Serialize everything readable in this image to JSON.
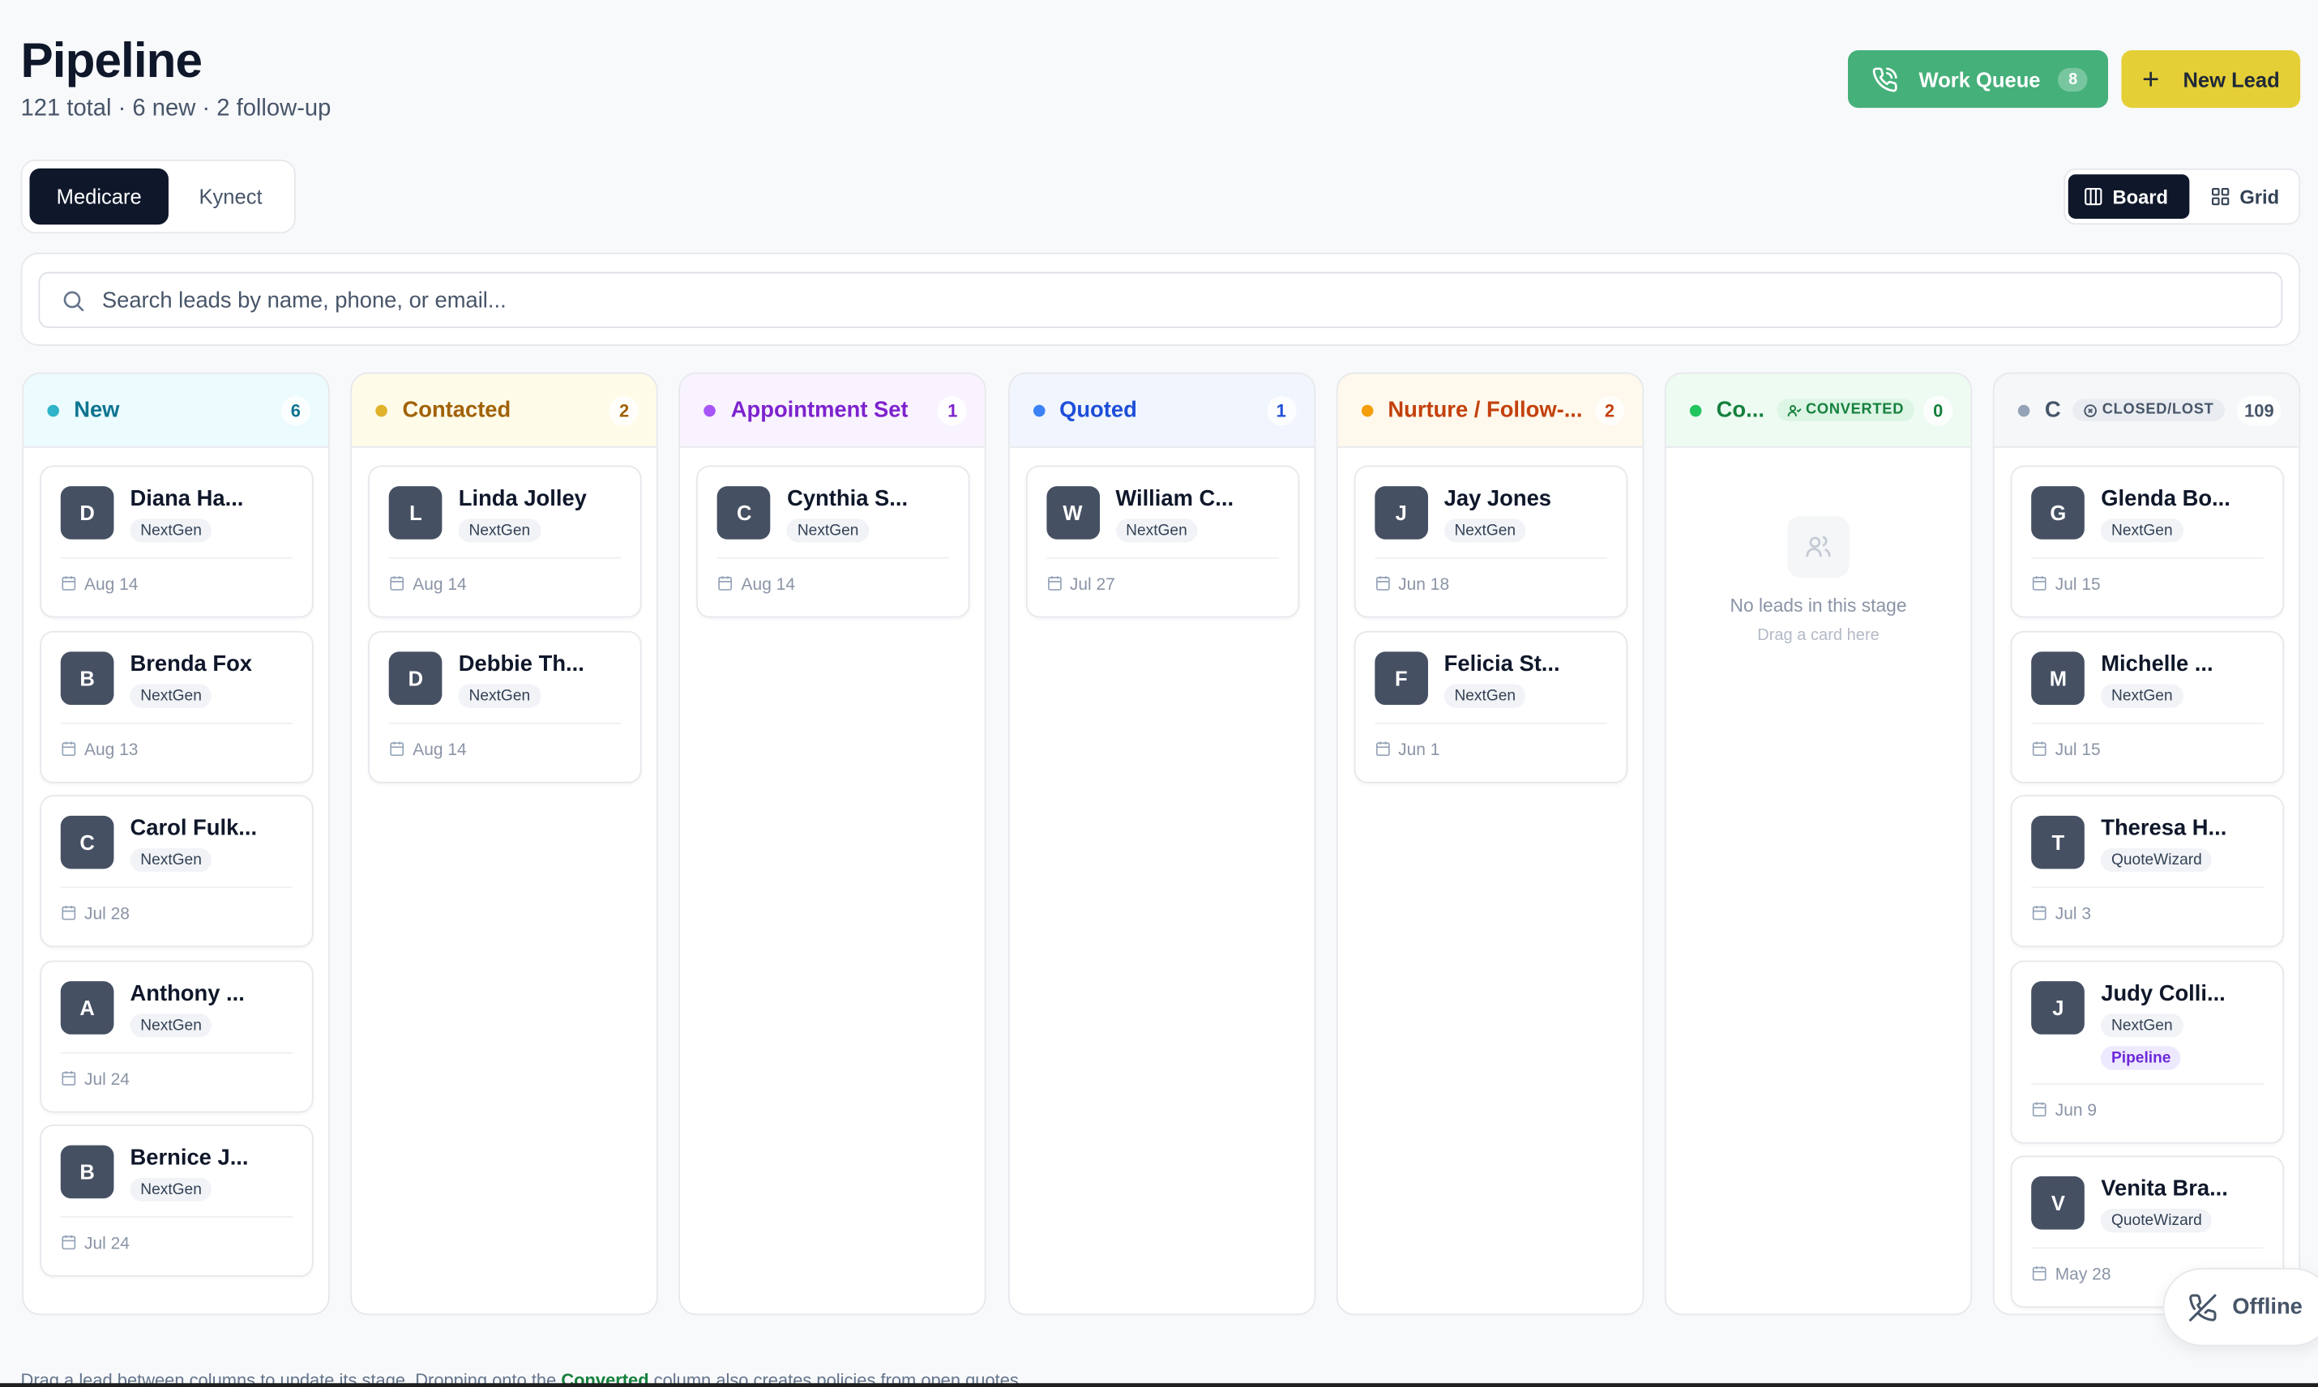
{
  "header": {
    "title": "Pipeline",
    "subtitle": "121 total · 6 new · 2 follow-up",
    "work_queue_label": "Work Queue",
    "work_queue_count": "8",
    "new_lead_label": "New Lead"
  },
  "product_tabs": [
    {
      "label": "Medicare",
      "active": true
    },
    {
      "label": "Kynect",
      "active": false
    }
  ],
  "view_toggle": {
    "board": "Board",
    "grid": "Grid",
    "active": "Board"
  },
  "search": {
    "placeholder": "Search leads by name, phone, or email..."
  },
  "columns": [
    {
      "name": "New",
      "count": "6",
      "color": "#2fb3c9",
      "text_color": "#0e7490",
      "head_bg": "#ecfbfd",
      "cards": [
        {
          "initial": "D",
          "name": "Diana Ha...",
          "source": "NextGen",
          "date": "Aug 14"
        },
        {
          "initial": "B",
          "name": "Brenda Fox",
          "source": "NextGen",
          "date": "Aug 13"
        },
        {
          "initial": "C",
          "name": "Carol Fulk...",
          "source": "NextGen",
          "date": "Jul 28"
        },
        {
          "initial": "A",
          "name": "Anthony ...",
          "source": "NextGen",
          "date": "Jul 24"
        },
        {
          "initial": "B",
          "name": "Bernice J...",
          "source": "NextGen",
          "date": "Jul 24"
        }
      ]
    },
    {
      "name": "Contacted",
      "count": "2",
      "color": "#e0b12a",
      "text_color": "#a16207",
      "head_bg": "#fefbe9",
      "cards": [
        {
          "initial": "L",
          "name": "Linda Jolley",
          "source": "NextGen",
          "date": "Aug 14"
        },
        {
          "initial": "D",
          "name": "Debbie Th...",
          "source": "NextGen",
          "date": "Aug 14"
        }
      ]
    },
    {
      "name": "Appointment Set",
      "count": "1",
      "color": "#a855f7",
      "text_color": "#7e22ce",
      "head_bg": "#f8f3fe",
      "cards": [
        {
          "initial": "C",
          "name": "Cynthia S...",
          "source": "NextGen",
          "date": "Aug 14"
        }
      ]
    },
    {
      "name": "Quoted",
      "count": "1",
      "color": "#3b82f6",
      "text_color": "#1d4ed8",
      "head_bg": "#f0f5fe",
      "cards": [
        {
          "initial": "W",
          "name": "William C...",
          "source": "NextGen",
          "date": "Jul 27"
        }
      ]
    },
    {
      "name": "Nurture / Follow-...",
      "count": "2",
      "color": "#f59e0b",
      "text_color": "#c2410c",
      "head_bg": "#fff8ec",
      "cards": [
        {
          "initial": "J",
          "name": "Jay Jones",
          "source": "NextGen",
          "date": "Jun 18"
        },
        {
          "initial": "F",
          "name": "Felicia St...",
          "source": "NextGen",
          "date": "Jun 1"
        }
      ]
    },
    {
      "name": "Co...",
      "count": "0",
      "color": "#22c55e",
      "text_color": "#15803d",
      "head_bg": "#eefbf2",
      "tag": "CONVERTED",
      "tag_color": "#15803d",
      "tag_bg": "#dcf5e4",
      "cards": [],
      "empty_title": "No leads in this stage",
      "empty_sub": "Drag a card here"
    },
    {
      "name": "C",
      "count": "109",
      "color": "#94a3b8",
      "text_color": "#475569",
      "head_bg": "#f6f7f9",
      "tag": "CLOSED/LOST",
      "tag_color": "#475569",
      "tag_bg": "#e9ecf0",
      "cards": [
        {
          "initial": "G",
          "name": "Glenda Bo...",
          "source": "NextGen",
          "date": "Jul 15"
        },
        {
          "initial": "M",
          "name": "Michelle ...",
          "source": "NextGen",
          "date": "Jul 15"
        },
        {
          "initial": "T",
          "name": "Theresa H...",
          "source": "QuoteWizard",
          "date": "Jul 3"
        },
        {
          "initial": "J",
          "name": "Judy Colli...",
          "source": "NextGen",
          "extra_tag": "Pipeline",
          "date": "Jun 9"
        },
        {
          "initial": "V",
          "name": "Venita Bra...",
          "source": "QuoteWizard",
          "date": "May 28"
        }
      ]
    }
  ],
  "offline_label": "Offline",
  "footer": {
    "before": "Drag a lead between columns to update its stage. Dropping onto the ",
    "highlight": "Converted",
    "after": " column also creates policies from open quotes."
  },
  "icons": {
    "work_queue": "phone-call-icon",
    "new_lead": "plus-icon",
    "board": "columns-icon",
    "grid": "grid-icon",
    "search": "search-icon",
    "date": "calendar-icon",
    "converted": "user-check-icon",
    "closed_lost": "x-circle-icon",
    "empty": "users-icon",
    "offline": "phone-off-icon"
  }
}
